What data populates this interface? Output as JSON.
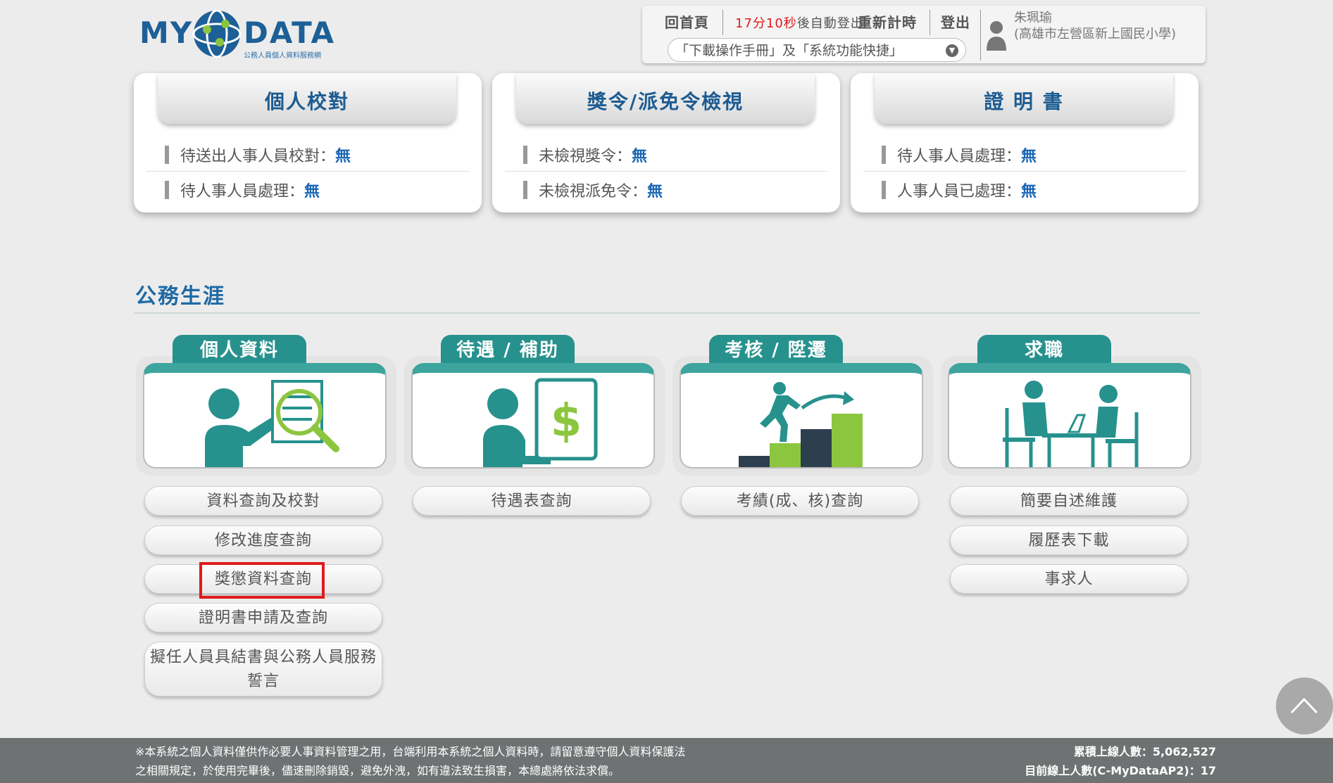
{
  "header": {
    "logo_text_left": "MY",
    "logo_text_right": "DATA",
    "logo_subtitle": "公務人員個人資料服務網",
    "home_link": "回首頁",
    "countdown": "17分10秒",
    "countdown_suffix": "後自動登出",
    "reset_timer": "重新計時",
    "logout": "登出",
    "dropdown_value": "「下載操作手冊」及「系統功能快捷」",
    "user_name": "朱珮瑜",
    "user_org": "(高雄市左營區新上國民小學)"
  },
  "status_cards": [
    {
      "title": "個人校對",
      "rows": [
        {
          "label": "待送出人事人員校對：",
          "value": "無"
        },
        {
          "label": "待人事人員處理：",
          "value": "無"
        }
      ]
    },
    {
      "title": "獎令/派免令檢視",
      "rows": [
        {
          "label": "未檢視獎令：",
          "value": "無"
        },
        {
          "label": "未檢視派免令：",
          "value": "無"
        }
      ]
    },
    {
      "title": "證 明 書",
      "rows": [
        {
          "label": "待人事人員處理：",
          "value": "無"
        },
        {
          "label": "人事人員已處理：",
          "value": "無"
        }
      ]
    }
  ],
  "section_title": "公務生涯",
  "categories": [
    {
      "title": "個人資料",
      "buttons": [
        "資料查詢及校對",
        "修改進度查詢",
        "獎懲資料查詢",
        "證明書申請及查詢",
        "擬任人員具結書與公務人員服務誓言"
      ]
    },
    {
      "title": "待遇 / 補助",
      "buttons": [
        "待遇表查詢"
      ]
    },
    {
      "title": "考核 / 陞遷",
      "buttons": [
        "考績(成、核)查詢"
      ]
    },
    {
      "title": "求職",
      "buttons": [
        "簡要自述維護",
        "履歷表下載",
        "事求人"
      ]
    }
  ],
  "footer": {
    "notice_line1": "※本系統之個人資料僅供作必要人事資料管理之用，台端利用本系統之個人資料時，請留意遵守個人資料保護法",
    "notice_line2": "之相關規定，於使用完畢後，儘速刪除銷毀，避免外洩，如有違法致生損害，本總處將依法求償。",
    "total_visitors": "累積上線人數：5,062,527",
    "current_online": "目前線上人數(C-MyDataAP2)：17"
  },
  "colors": {
    "teal": "#27918d",
    "blue": "#1d5c92",
    "highlight": "#e01b1b",
    "green": "#8cc63f"
  }
}
